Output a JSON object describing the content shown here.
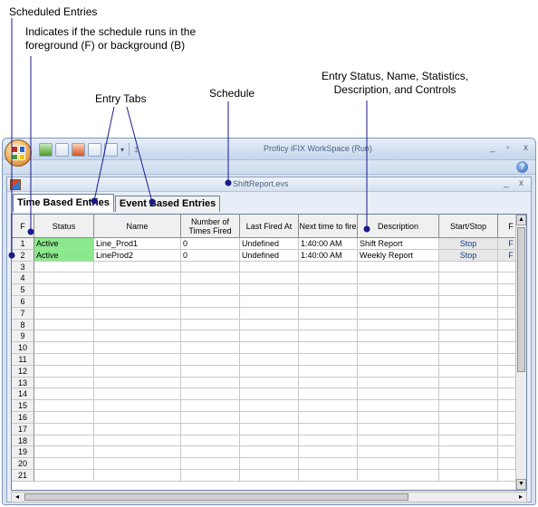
{
  "annotations": {
    "scheduled_entries": "Scheduled Entries",
    "fb_line1": "Indicates if the schedule runs in the",
    "fb_line2": "foreground (F) or background (B)",
    "entry_status_line1": "Entry Status, Name, Statistics,",
    "entry_status_line2": "Description, and Controls",
    "entry_tabs": "Entry Tabs",
    "schedule": "Schedule"
  },
  "window": {
    "title": "Proficy iFIX WorkSpace (Run)",
    "minimize": "_",
    "maximize": "▫",
    "close": "x",
    "help": "?",
    "qat_overflow": "▾"
  },
  "document": {
    "title": "ShiftReport.evs",
    "minimize": "_",
    "close": "x"
  },
  "tabs": [
    "Time Based Entries",
    "Event Based Entries"
  ],
  "grid": {
    "columns": [
      "F",
      "Status",
      "Name",
      "Number of Times Fired",
      "Last Fired At",
      "Next time to fire",
      "Description",
      "Start/Stop",
      "F"
    ],
    "rows": [
      {
        "num": "1",
        "status": "Active",
        "name": "Line_Prod1",
        "times_fired": "0",
        "last_fired": "Undefined",
        "next_fire": "1:40:00 AM",
        "description": "Shift Report",
        "control": "Stop",
        "extra": "F"
      },
      {
        "num": "2",
        "status": "Active",
        "name": "LineProd2",
        "times_fired": "0",
        "last_fired": "Undefined",
        "next_fire": "1:40:00 AM",
        "description": "Weekly Report",
        "control": "Stop",
        "extra": "F"
      },
      {
        "num": "3"
      },
      {
        "num": "4"
      },
      {
        "num": "5"
      },
      {
        "num": "6"
      },
      {
        "num": "7"
      },
      {
        "num": "8"
      },
      {
        "num": "9"
      },
      {
        "num": "10"
      },
      {
        "num": "11"
      },
      {
        "num": "12"
      },
      {
        "num": "13"
      },
      {
        "num": "14"
      },
      {
        "num": "15"
      },
      {
        "num": "16"
      },
      {
        "num": "17"
      },
      {
        "num": "18"
      },
      {
        "num": "19"
      },
      {
        "num": "20"
      },
      {
        "num": "21"
      }
    ],
    "status_color": "#8ce88c"
  }
}
